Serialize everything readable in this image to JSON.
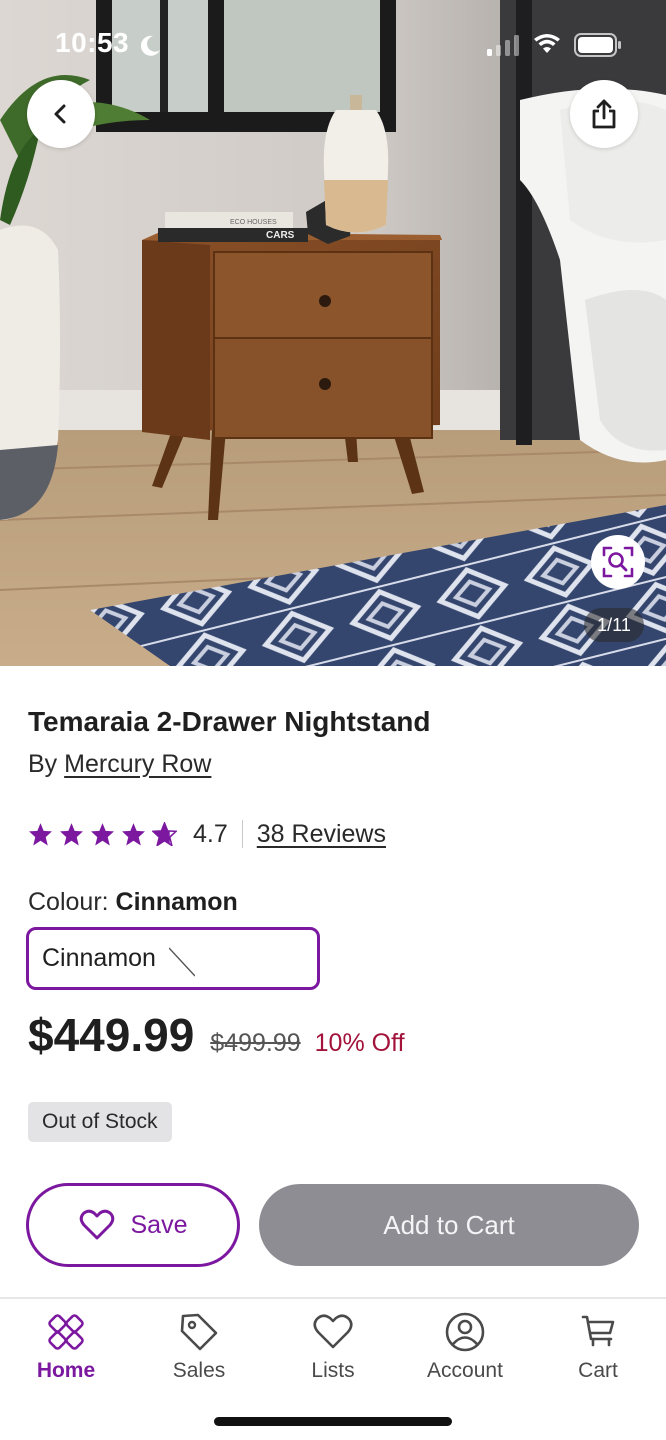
{
  "status_bar": {
    "time": "10:53",
    "icons": [
      "moon-icon",
      "signal-icon",
      "wifi-icon",
      "battery-icon"
    ]
  },
  "gallery": {
    "counter": "1/11",
    "book_spine_text": "ECO HOUSES",
    "book_cover_text": "CARS",
    "icons": [
      "back-arrow-icon",
      "share-icon",
      "visual-search-icon"
    ]
  },
  "product": {
    "title": "Temaraia 2-Drawer Nightstand",
    "by_prefix": "By",
    "brand": "Mercury Row",
    "rating": "4.7",
    "rating_fraction_filled": 0.94,
    "reviews_label": "38 Reviews",
    "colour_label": "Colour:",
    "colour_value": "Cinnamon",
    "swatch_label": "Cinnamon",
    "price": "$449.99",
    "was_price": "$499.99",
    "discount": "10% Off",
    "stock_badge": "Out of Stock"
  },
  "actions": {
    "save_label": "Save",
    "add_to_cart_label": "Add to Cart"
  },
  "tabbar": {
    "items": [
      {
        "label": "Home",
        "icon": "home-icon",
        "active": true
      },
      {
        "label": "Sales",
        "icon": "tag-icon",
        "active": false
      },
      {
        "label": "Lists",
        "icon": "heart-icon",
        "active": false
      },
      {
        "label": "Account",
        "icon": "account-icon",
        "active": false
      },
      {
        "label": "Cart",
        "icon": "cart-icon",
        "active": false
      }
    ]
  },
  "colors": {
    "brand_purple": "#7b189f",
    "discount_red": "#a3123a",
    "disabled_button": "#8d8d93",
    "stock_badge_bg": "#e3e3e6"
  }
}
